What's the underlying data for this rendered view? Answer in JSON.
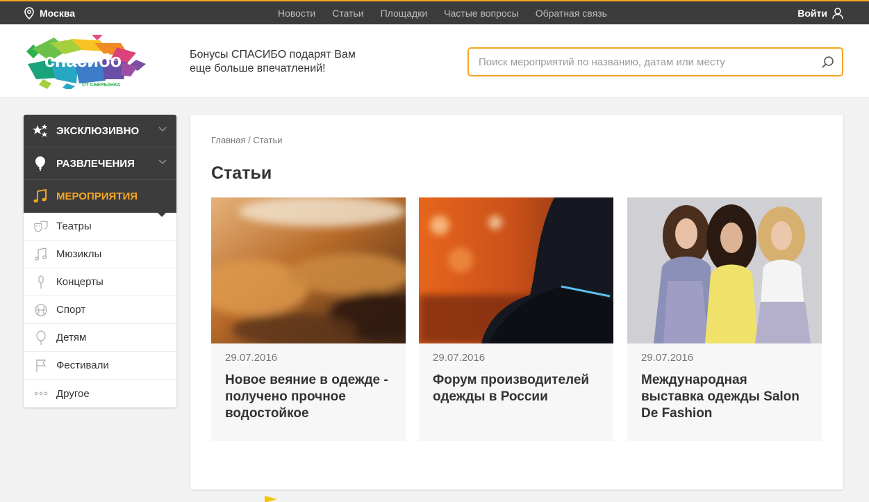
{
  "topbar": {
    "city": "Москва",
    "nav": [
      "Новости",
      "Статьи",
      "Площадки",
      "Частые вопросы",
      "Обратная связь"
    ],
    "login": "Войти"
  },
  "header": {
    "logo_text": "спасибо",
    "logo_sub": "ОТ СБЕРБАНКА",
    "tagline_line1": "Бонусы СПАСИБО подарят Вам",
    "tagline_line2": "еще больше впечатлений!",
    "search_placeholder": "Поиск мероприятий по названию, датам или месту"
  },
  "sidebar": {
    "categories": [
      {
        "label": "ЭКСКЛЮЗИВНО",
        "icon": "stars-icon"
      },
      {
        "label": "РАЗВЛЕЧЕНИЯ",
        "icon": "balloon-icon"
      },
      {
        "label": "МЕРОПРИЯТИЯ",
        "icon": "music-note-icon"
      }
    ],
    "items": [
      {
        "label": "Театры",
        "icon": "theater-masks-icon"
      },
      {
        "label": "Мюзиклы",
        "icon": "music-note-icon"
      },
      {
        "label": "Концерты",
        "icon": "microphone-icon"
      },
      {
        "label": "Спорт",
        "icon": "ball-icon"
      },
      {
        "label": "Детям",
        "icon": "balloon-icon"
      },
      {
        "label": "Фестивали",
        "icon": "flag-icon"
      },
      {
        "label": "Другое",
        "icon": "dots-icon"
      }
    ]
  },
  "main": {
    "breadcrumb_home": "Главная",
    "breadcrumb_sep": "/",
    "breadcrumb_current": "Статьи",
    "title": "Статьи",
    "cards": [
      {
        "date": "29.07.2016",
        "title": "Новое веяние в одежде - получено прочное водостойкое"
      },
      {
        "date": "29.07.2016",
        "title": "Форум производителей одежды в России"
      },
      {
        "date": "29.07.2016",
        "title": "Международная выставка одежды Salon De Fashion"
      }
    ]
  },
  "colors": {
    "accent": "#f5a623",
    "dark": "#3c3c3c",
    "logo_green": "#2bb24c"
  }
}
